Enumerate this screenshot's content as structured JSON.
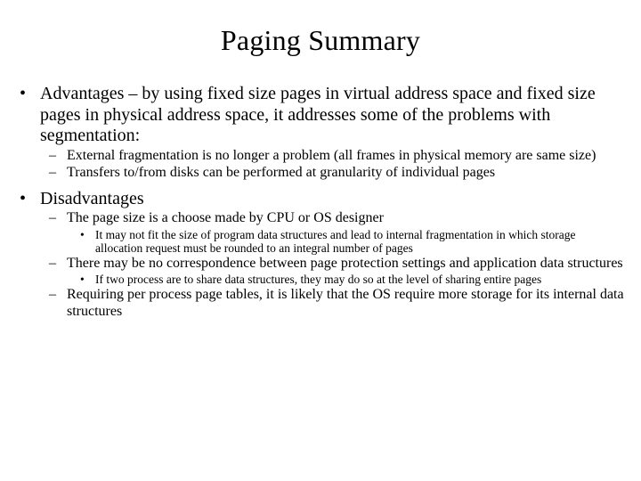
{
  "slide": {
    "title": "Paging Summary",
    "background_color": "#ffffff",
    "text_color": "#000000",
    "bullet_marks": {
      "level1": "•",
      "level2": "–",
      "level3": "•"
    },
    "content": [
      {
        "level": 1,
        "text": "Advantages – by using fixed size pages in virtual address space and fixed size pages in physical address space, it addresses some of the problems with segmentation:"
      },
      {
        "level": 2,
        "text": "External fragmentation is no longer a problem (all frames in physical memory are same size)"
      },
      {
        "level": 2,
        "text": "Transfers to/from disks can be performed at granularity of individual pages"
      },
      {
        "level": 1,
        "text": "Disadvantages"
      },
      {
        "level": 2,
        "text": "The page size is a choose made by CPU or OS designer"
      },
      {
        "level": 3,
        "text": "It may not fit the size of program data structures and lead to internal fragmentation in which storage allocation request must be rounded to an integral number of pages"
      },
      {
        "level": 2,
        "text": "There may be no correspondence between page protection settings and application data structures"
      },
      {
        "level": 3,
        "text": "If two process are to share data structures, they may do so at the level of sharing entire pages"
      },
      {
        "level": 2,
        "text": "Requiring per process page tables, it is likely that the OS require more storage for its internal data structures"
      }
    ]
  }
}
